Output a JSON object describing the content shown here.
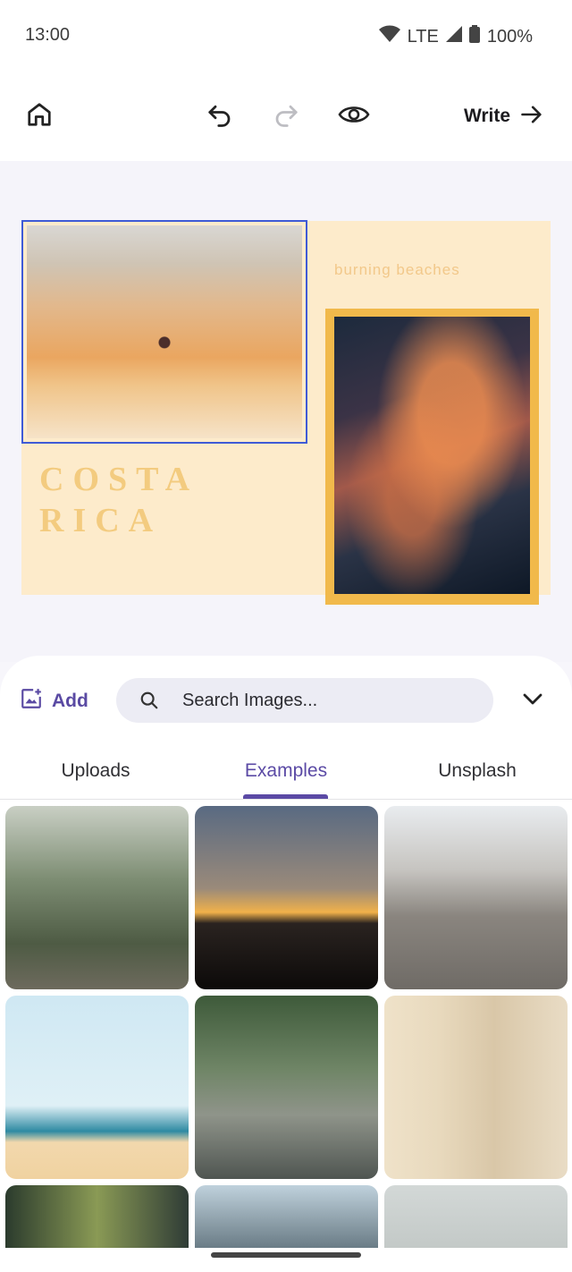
{
  "status_bar": {
    "time": "13:00",
    "network": "LTE",
    "battery": "100%"
  },
  "toolbar": {
    "write_label": "Write"
  },
  "design": {
    "title": "COSTA\nRICA",
    "subtitle": "burning beaches"
  },
  "sheet": {
    "add_label": "Add",
    "search_placeholder": "Search Images...",
    "tabs": [
      {
        "label": "Uploads"
      },
      {
        "label": "Examples"
      },
      {
        "label": "Unsplash"
      }
    ],
    "active_tab": "Examples"
  },
  "colors": {
    "accent": "#5b4aa5",
    "selection": "#3f5bd6",
    "page_bg": "#fdebcb",
    "title_gold": "#f3cb7f",
    "frame": "#f1b94b"
  },
  "icons": [
    "home-icon",
    "undo-icon",
    "redo-icon",
    "eye-icon",
    "arrow-right-icon",
    "add-image-icon",
    "search-icon",
    "chevron-down-icon",
    "wifi-icon",
    "signal-icon",
    "battery-icon"
  ]
}
